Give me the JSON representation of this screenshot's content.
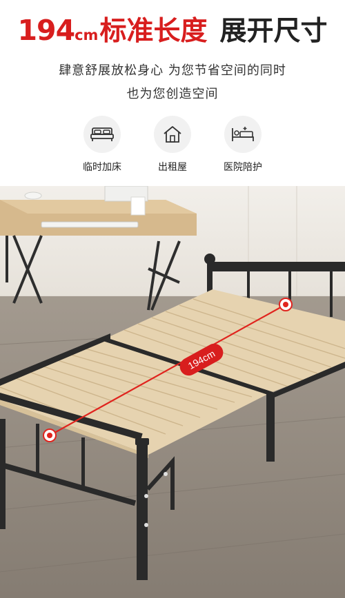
{
  "header": {
    "size_number": "194",
    "size_unit": "cm",
    "red_text": "标准长度",
    "black_text": "展开尺寸"
  },
  "subtitle": {
    "line1": "肆意舒展放松身心 为您节省空间的同时",
    "line2": "也为您创造空间"
  },
  "uses": [
    {
      "icon": "bed-icon",
      "label": "临时加床"
    },
    {
      "icon": "house-icon",
      "label": "出租屋"
    },
    {
      "icon": "hospital-bed-icon",
      "label": "医院陪护"
    }
  ],
  "photo": {
    "measure_label": "194cm"
  },
  "colors": {
    "accent_red": "#d81e1e",
    "frame_black": "#2a2a2a",
    "slat_wood": "#e6d3b0",
    "floor_wood": "#8d8479"
  }
}
